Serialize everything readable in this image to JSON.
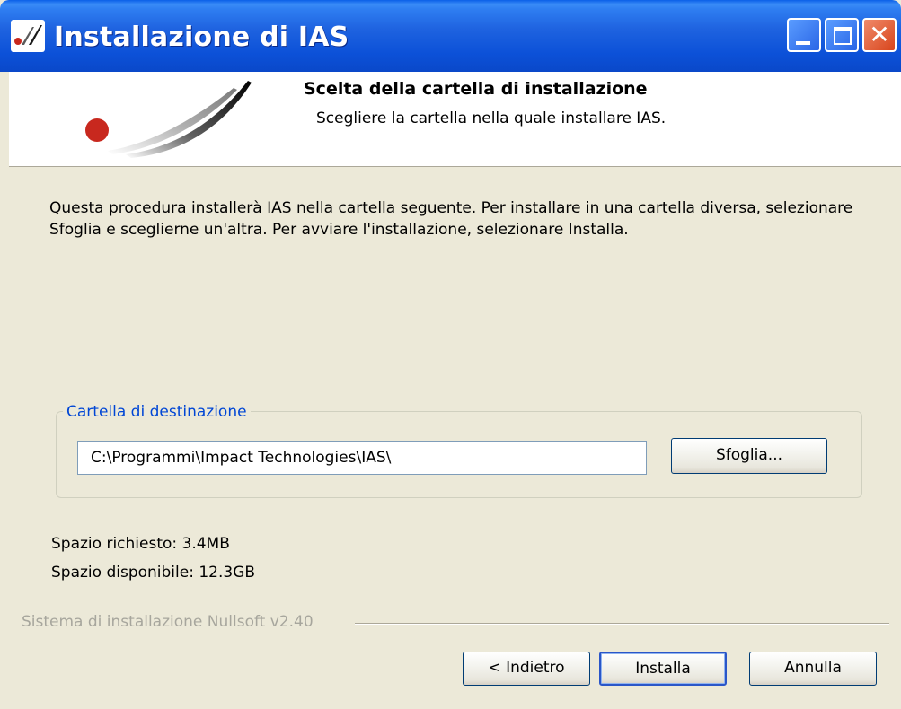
{
  "window": {
    "title": "Installazione di IAS",
    "title_bar_color": "#0a54e3",
    "icon": "ias-app-icon"
  },
  "title_buttons": {
    "minimize_icon": "minimize-icon",
    "maximize_icon": "maximize-icon",
    "close_icon": "close-icon",
    "close_glyph": "✕"
  },
  "header": {
    "title": "Scelta della cartella di installazione",
    "subtitle": "Scegliere la cartella nella quale installare IAS.",
    "logo": "ias-logo",
    "logo_dot_color": "#c8281e"
  },
  "body": {
    "description": "Questa procedura installerà IAS nella cartella seguente. Per installare in una cartella diversa, selezionare Sfoglia e sceglierne un'altra. Per avviare l'installazione, selezionare Installa."
  },
  "destination": {
    "group_label": "Cartella di destinazione",
    "path_value": "C:\\Programmi\\Impact Technologies\\IAS\\",
    "browse_label": "Sfoglia..."
  },
  "space": {
    "required": "Spazio richiesto: 3.4MB",
    "available": "Spazio disponibile: 12.3GB"
  },
  "footer": {
    "branding": "Sistema di installazione Nullsoft v2.40",
    "back_label": "< Indietro",
    "install_label": "Installa",
    "cancel_label": "Annulla"
  }
}
